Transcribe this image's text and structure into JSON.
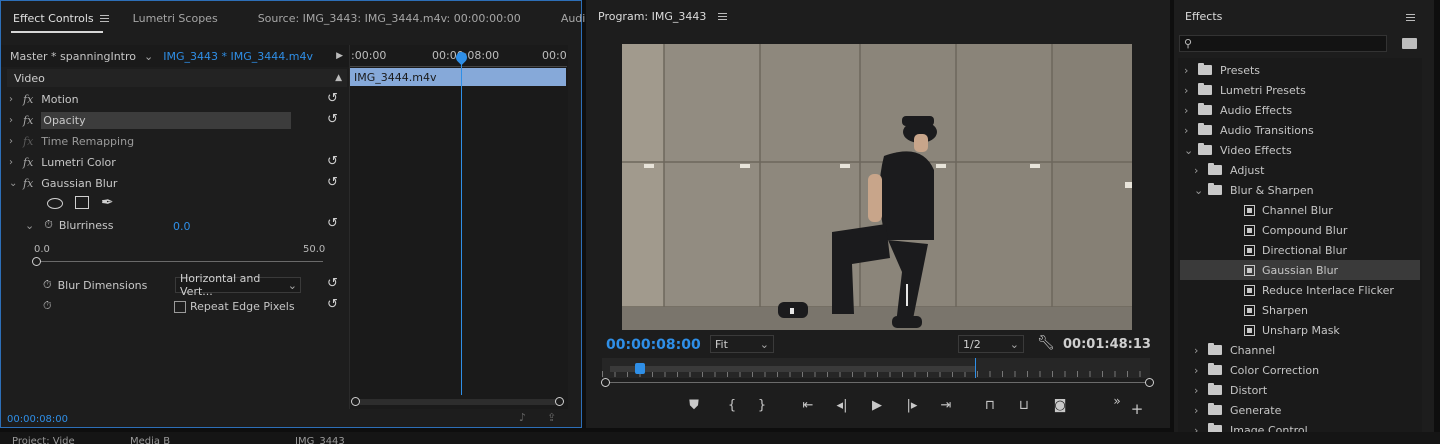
{
  "effect_controls": {
    "tabs": [
      "Effect Controls",
      "Lumetri Scopes",
      "Source: IMG_3443: IMG_3444.m4v: 00:00:00:00",
      "Audio"
    ],
    "master_label": "Master * spanningIntro",
    "clip_label": "IMG_3443 * IMG_3444.m4v",
    "video_label": "Video",
    "effects": [
      "Motion",
      "Opacity",
      "Time Remapping",
      "Lumetri Color",
      "Gaussian Blur"
    ],
    "blurriness_label": "Blurriness",
    "blurriness_value": "0.0",
    "slider_min": "0.0",
    "slider_max": "50.0",
    "blur_dimensions_label": "Blur Dimensions",
    "blur_dimensions_value": "Horizontal and Vert...",
    "repeat_edge_label": "Repeat Edge Pixels",
    "timecode": "00:00:08:00",
    "ruler_ticks": [
      ":00:00",
      "00:00:08:00",
      "00:0"
    ],
    "clip_name": "IMG_3444.m4v"
  },
  "program": {
    "title": "Program: IMG_3443",
    "timecode": "00:00:08:00",
    "fit": "Fit",
    "resolution": "1/2",
    "duration": "00:01:48:13",
    "playhead_fraction": 0.06,
    "inout_end_fraction": 0.68
  },
  "effects_panel": {
    "title": "Effects",
    "items": [
      {
        "label": "Presets",
        "kind": "preset-folder",
        "indent": 0,
        "open": false
      },
      {
        "label": "Lumetri Presets",
        "kind": "preset-folder",
        "indent": 0,
        "open": false
      },
      {
        "label": "Audio Effects",
        "kind": "folder",
        "indent": 0,
        "open": false
      },
      {
        "label": "Audio Transitions",
        "kind": "folder",
        "indent": 0,
        "open": false
      },
      {
        "label": "Video Effects",
        "kind": "folder",
        "indent": 0,
        "open": true
      },
      {
        "label": "Adjust",
        "kind": "folder",
        "indent": 1,
        "open": false
      },
      {
        "label": "Blur & Sharpen",
        "kind": "folder",
        "indent": 1,
        "open": true
      },
      {
        "label": "Channel Blur",
        "kind": "effect",
        "indent": 2
      },
      {
        "label": "Compound Blur",
        "kind": "effect",
        "indent": 2
      },
      {
        "label": "Directional Blur",
        "kind": "effect",
        "indent": 2
      },
      {
        "label": "Gaussian Blur",
        "kind": "effect",
        "indent": 2,
        "selected": true
      },
      {
        "label": "Reduce Interlace Flicker",
        "kind": "effect",
        "indent": 2
      },
      {
        "label": "Sharpen",
        "kind": "effect",
        "indent": 2
      },
      {
        "label": "Unsharp Mask",
        "kind": "effect",
        "indent": 2
      },
      {
        "label": "Channel",
        "kind": "folder",
        "indent": 1,
        "open": false
      },
      {
        "label": "Color Correction",
        "kind": "folder",
        "indent": 1,
        "open": false
      },
      {
        "label": "Distort",
        "kind": "folder",
        "indent": 1,
        "open": false
      },
      {
        "label": "Generate",
        "kind": "folder",
        "indent": 1,
        "open": false
      },
      {
        "label": "Image Control",
        "kind": "folder",
        "indent": 1,
        "open": false
      }
    ]
  },
  "bottom_tabs": [
    "Project: Vide",
    "Media B",
    "IMG_3443"
  ],
  "colors": {
    "accent": "#2f8fe7",
    "panel": "#1d1d1d",
    "clip": "#86a9d9"
  }
}
